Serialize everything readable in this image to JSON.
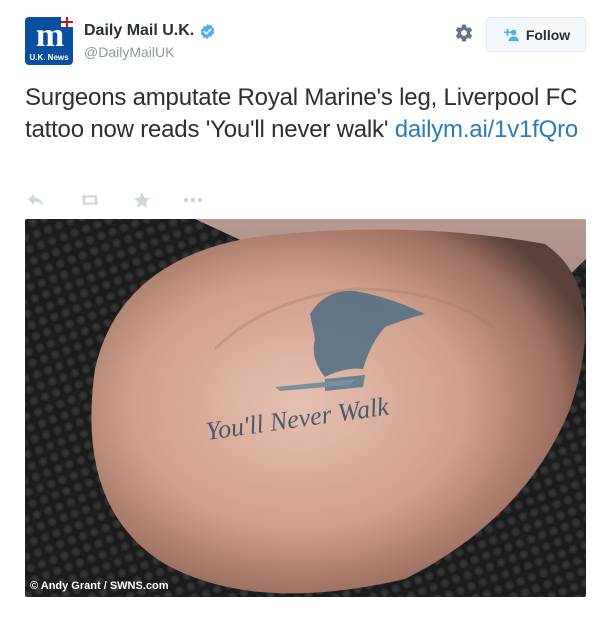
{
  "account": {
    "display_name": "Daily Mail U.K.",
    "handle": "@DailyMailUK",
    "avatar_monogram": "m",
    "avatar_caption": "U.K. News",
    "verified": true
  },
  "header": {
    "follow_label": "Follow"
  },
  "tweet": {
    "text": "Surgeons amputate Royal Marine's leg, Liverpool FC tattoo now reads 'You'll never walk' ",
    "link_text": "dailym.ai/1v1fQro"
  },
  "actions": [
    {
      "name": "reply-icon",
      "label": "reply"
    },
    {
      "name": "retweet-icon",
      "label": "retweet"
    },
    {
      "name": "favorite-icon",
      "label": "favorite"
    },
    {
      "name": "more-icon",
      "label": "more"
    }
  ],
  "media": {
    "tattoo_text": "You'll Never Walk",
    "credit": "© Andy Grant / SWNS.com"
  },
  "colors": {
    "link": "#2b7bb9",
    "verified": "#55acee",
    "avatar": "#0a4ea0",
    "icon_muted": "#ccd6dd"
  }
}
